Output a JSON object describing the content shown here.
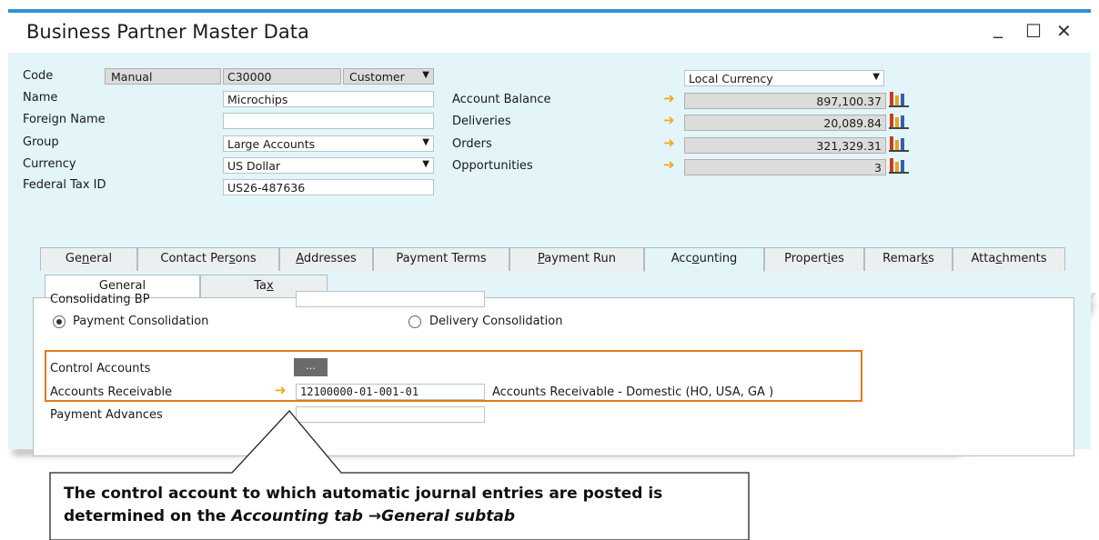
{
  "window": {
    "title": "Business Partner Master Data",
    "minimize": "_",
    "maximize": "☐",
    "close": "✕"
  },
  "header": {
    "code_label": "Code",
    "code_mode": "Manual",
    "code_value": "C30000",
    "bp_type": "Customer",
    "name_label": "Name",
    "name_value": "Microchips",
    "foreign_name_label": "Foreign Name",
    "foreign_name_value": "",
    "group_label": "Group",
    "group_value": "Large Accounts",
    "currency_label": "Currency",
    "currency_value": "US Dollar",
    "tax_id_label": "Federal Tax ID",
    "tax_id_value": "US26-487636"
  },
  "balances": {
    "currency_select": "Local Currency",
    "rows": [
      {
        "label": "Account Balance",
        "value": "897,100.37"
      },
      {
        "label": "Deliveries",
        "value": "20,089.84"
      },
      {
        "label": "Orders",
        "value": "321,329.31"
      },
      {
        "label": "Opportunities",
        "value": "3"
      }
    ]
  },
  "tabs": [
    {
      "pre": "Ge",
      "ul": "n",
      "post": "eral"
    },
    {
      "pre": "Contact Per",
      "ul": "s",
      "post": "ons"
    },
    {
      "pre": "",
      "ul": "A",
      "post": "ddresses"
    },
    {
      "pre": "Payment Terms",
      "ul": "",
      "post": ""
    },
    {
      "pre": "",
      "ul": "P",
      "post": "ayment Run"
    },
    {
      "pre": "Acc",
      "ul": "o",
      "post": "unting"
    },
    {
      "pre": "Propert",
      "ul": "i",
      "post": "es"
    },
    {
      "pre": "Remar",
      "ul": "k",
      "post": "s"
    },
    {
      "pre": "Atta",
      "ul": "c",
      "post": "hments"
    }
  ],
  "subtabs": [
    {
      "pre": "General",
      "ul": "",
      "post": ""
    },
    {
      "pre": "Ta",
      "ul": "x",
      "post": ""
    }
  ],
  "accounting": {
    "consolidating_bp_label": "Consolidating BP",
    "consolidating_bp_value": "",
    "payment_consolidation": "Payment Consolidation",
    "delivery_consolidation": "Delivery Consolidation",
    "control_accounts_label": "Control Accounts",
    "ellipsis": "...",
    "accounts_receivable_label": "Accounts Receivable",
    "accounts_receivable_value": "12100000-01-001-01",
    "accounts_receivable_name": "Accounts Receivable - Domestic (HO, USA, GA )",
    "payment_advances_label": "Payment Advances",
    "payment_advances_value": ""
  },
  "callout": {
    "line1": "The control account to which automatic journal entries are posted is",
    "line2_prefix": "determined on the ",
    "line2_italic": "Accounting tab →General subtab"
  },
  "colors": {
    "accent": "#2b93d5",
    "highlight": "#e07b1a",
    "link_arrow": "#f4a81a",
    "form_bg": "#e3f5f8"
  }
}
